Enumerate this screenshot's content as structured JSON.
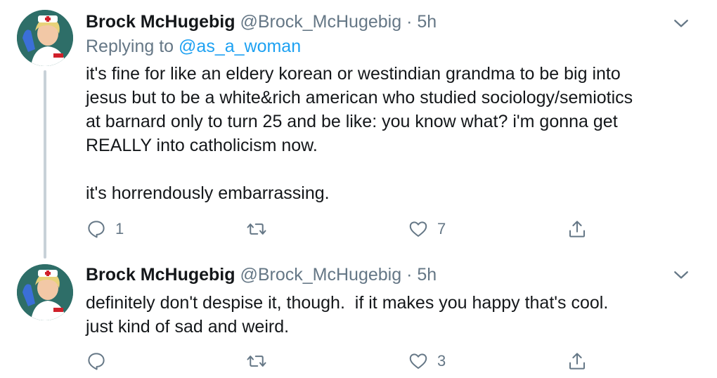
{
  "tweets": [
    {
      "author_name": "Brock McHugebig",
      "author_handle": "@Brock_McHugebig",
      "separator": "·",
      "time": "5h",
      "replying_prefix": "Replying to",
      "replying_to": "@as_a_woman",
      "text": "it's fine for like an eldery korean or westindian grandma to be big into\njesus but to be a white&rich american who studied sociology/semiotics\nat barnard only to turn 25 and be like: you know what? i'm gonna get\nREALLY into catholicism now.\n\nit's horrendously embarrassing.",
      "reply_count": "1",
      "retweet_count": "",
      "like_count": "7"
    },
    {
      "author_name": "Brock McHugebig",
      "author_handle": "@Brock_McHugebig",
      "separator": "·",
      "time": "5h",
      "text": "definitely don't despise it, though.  if it makes you happy that's cool.\njust kind of sad and weird.",
      "reply_count": "",
      "retweet_count": "",
      "like_count": "3"
    }
  ],
  "icons": {
    "avatar": "avatar-image",
    "caret": "chevron-down-icon",
    "reply": "reply-icon",
    "retweet": "retweet-icon",
    "like": "heart-icon",
    "share": "share-icon"
  },
  "colors": {
    "text": "#14171a",
    "secondary": "#657786",
    "link": "#1da1f2",
    "thread_line": "#c8d1d8"
  }
}
